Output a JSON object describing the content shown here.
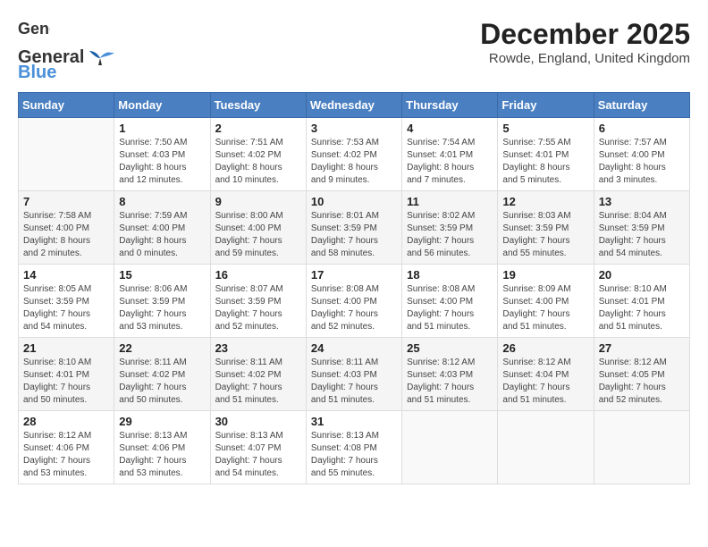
{
  "header": {
    "logo_general": "General",
    "logo_blue": "Blue",
    "month_title": "December 2025",
    "location": "Rowde, England, United Kingdom"
  },
  "weekdays": [
    "Sunday",
    "Monday",
    "Tuesday",
    "Wednesday",
    "Thursday",
    "Friday",
    "Saturday"
  ],
  "weeks": [
    [
      {
        "day": "",
        "info": ""
      },
      {
        "day": "1",
        "info": "Sunrise: 7:50 AM\nSunset: 4:03 PM\nDaylight: 8 hours\nand 12 minutes."
      },
      {
        "day": "2",
        "info": "Sunrise: 7:51 AM\nSunset: 4:02 PM\nDaylight: 8 hours\nand 10 minutes."
      },
      {
        "day": "3",
        "info": "Sunrise: 7:53 AM\nSunset: 4:02 PM\nDaylight: 8 hours\nand 9 minutes."
      },
      {
        "day": "4",
        "info": "Sunrise: 7:54 AM\nSunset: 4:01 PM\nDaylight: 8 hours\nand 7 minutes."
      },
      {
        "day": "5",
        "info": "Sunrise: 7:55 AM\nSunset: 4:01 PM\nDaylight: 8 hours\nand 5 minutes."
      },
      {
        "day": "6",
        "info": "Sunrise: 7:57 AM\nSunset: 4:00 PM\nDaylight: 8 hours\nand 3 minutes."
      }
    ],
    [
      {
        "day": "7",
        "info": "Sunrise: 7:58 AM\nSunset: 4:00 PM\nDaylight: 8 hours\nand 2 minutes."
      },
      {
        "day": "8",
        "info": "Sunrise: 7:59 AM\nSunset: 4:00 PM\nDaylight: 8 hours\nand 0 minutes."
      },
      {
        "day": "9",
        "info": "Sunrise: 8:00 AM\nSunset: 4:00 PM\nDaylight: 7 hours\nand 59 minutes."
      },
      {
        "day": "10",
        "info": "Sunrise: 8:01 AM\nSunset: 3:59 PM\nDaylight: 7 hours\nand 58 minutes."
      },
      {
        "day": "11",
        "info": "Sunrise: 8:02 AM\nSunset: 3:59 PM\nDaylight: 7 hours\nand 56 minutes."
      },
      {
        "day": "12",
        "info": "Sunrise: 8:03 AM\nSunset: 3:59 PM\nDaylight: 7 hours\nand 55 minutes."
      },
      {
        "day": "13",
        "info": "Sunrise: 8:04 AM\nSunset: 3:59 PM\nDaylight: 7 hours\nand 54 minutes."
      }
    ],
    [
      {
        "day": "14",
        "info": "Sunrise: 8:05 AM\nSunset: 3:59 PM\nDaylight: 7 hours\nand 54 minutes."
      },
      {
        "day": "15",
        "info": "Sunrise: 8:06 AM\nSunset: 3:59 PM\nDaylight: 7 hours\nand 53 minutes."
      },
      {
        "day": "16",
        "info": "Sunrise: 8:07 AM\nSunset: 3:59 PM\nDaylight: 7 hours\nand 52 minutes."
      },
      {
        "day": "17",
        "info": "Sunrise: 8:08 AM\nSunset: 4:00 PM\nDaylight: 7 hours\nand 52 minutes."
      },
      {
        "day": "18",
        "info": "Sunrise: 8:08 AM\nSunset: 4:00 PM\nDaylight: 7 hours\nand 51 minutes."
      },
      {
        "day": "19",
        "info": "Sunrise: 8:09 AM\nSunset: 4:00 PM\nDaylight: 7 hours\nand 51 minutes."
      },
      {
        "day": "20",
        "info": "Sunrise: 8:10 AM\nSunset: 4:01 PM\nDaylight: 7 hours\nand 51 minutes."
      }
    ],
    [
      {
        "day": "21",
        "info": "Sunrise: 8:10 AM\nSunset: 4:01 PM\nDaylight: 7 hours\nand 50 minutes."
      },
      {
        "day": "22",
        "info": "Sunrise: 8:11 AM\nSunset: 4:02 PM\nDaylight: 7 hours\nand 50 minutes."
      },
      {
        "day": "23",
        "info": "Sunrise: 8:11 AM\nSunset: 4:02 PM\nDaylight: 7 hours\nand 51 minutes."
      },
      {
        "day": "24",
        "info": "Sunrise: 8:11 AM\nSunset: 4:03 PM\nDaylight: 7 hours\nand 51 minutes."
      },
      {
        "day": "25",
        "info": "Sunrise: 8:12 AM\nSunset: 4:03 PM\nDaylight: 7 hours\nand 51 minutes."
      },
      {
        "day": "26",
        "info": "Sunrise: 8:12 AM\nSunset: 4:04 PM\nDaylight: 7 hours\nand 51 minutes."
      },
      {
        "day": "27",
        "info": "Sunrise: 8:12 AM\nSunset: 4:05 PM\nDaylight: 7 hours\nand 52 minutes."
      }
    ],
    [
      {
        "day": "28",
        "info": "Sunrise: 8:12 AM\nSunset: 4:06 PM\nDaylight: 7 hours\nand 53 minutes."
      },
      {
        "day": "29",
        "info": "Sunrise: 8:13 AM\nSunset: 4:06 PM\nDaylight: 7 hours\nand 53 minutes."
      },
      {
        "day": "30",
        "info": "Sunrise: 8:13 AM\nSunset: 4:07 PM\nDaylight: 7 hours\nand 54 minutes."
      },
      {
        "day": "31",
        "info": "Sunrise: 8:13 AM\nSunset: 4:08 PM\nDaylight: 7 hours\nand 55 minutes."
      },
      {
        "day": "",
        "info": ""
      },
      {
        "day": "",
        "info": ""
      },
      {
        "day": "",
        "info": ""
      }
    ]
  ]
}
